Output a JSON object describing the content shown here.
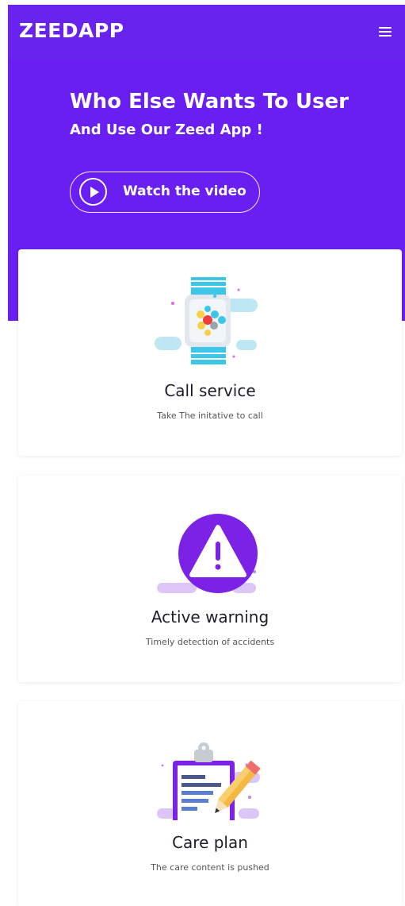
{
  "header": {
    "logo": "ZEEDAPP",
    "menu_icon": "hamburger-icon"
  },
  "hero": {
    "title": "Who Else Wants To User",
    "subtitle": "And Use Our Zeed App !",
    "video_button_label": "Watch the video",
    "video_button_icon": "play-icon"
  },
  "colors": {
    "brand": "#6a1ff2",
    "card_accent": "#7b22e6"
  },
  "features": [
    {
      "title": "Call service",
      "description": "Take The initative to call",
      "icon": "smartwatch-icon"
    },
    {
      "title": "Active warning",
      "description": "Timely detection of accidents",
      "icon": "warning-icon"
    },
    {
      "title": "Care plan",
      "description": "The care content is pushed",
      "icon": "clipboard-pencil-icon"
    }
  ]
}
